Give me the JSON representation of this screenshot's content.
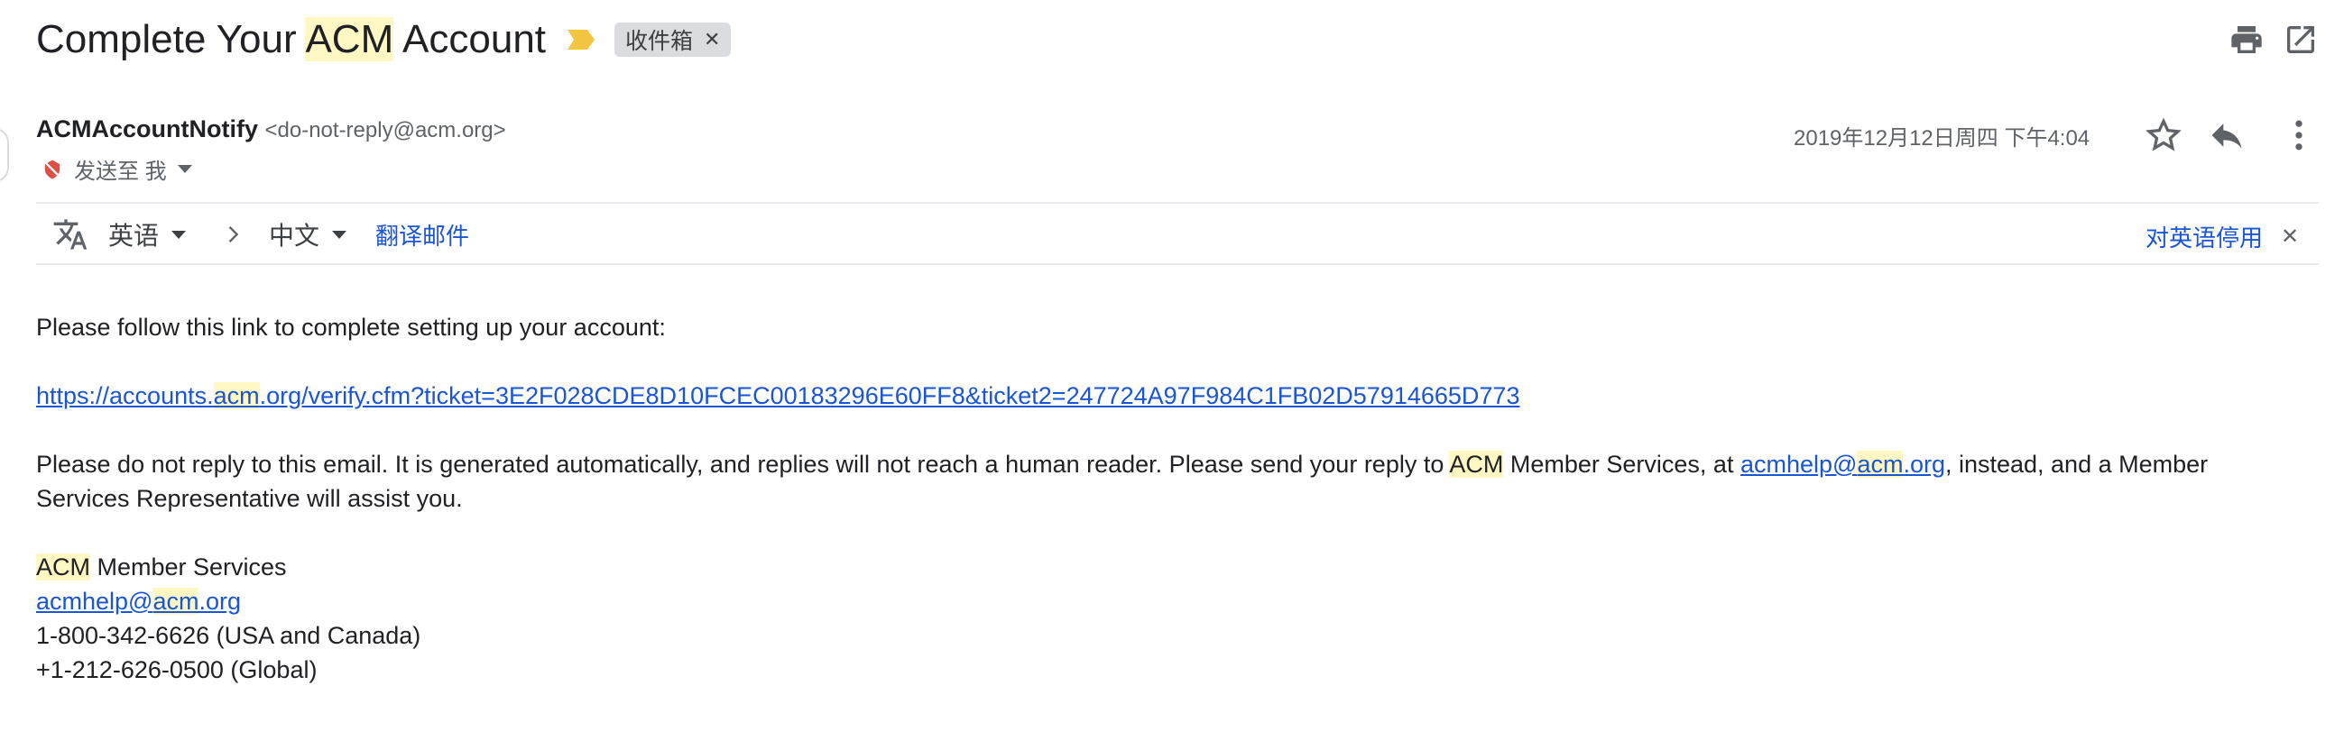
{
  "subject": {
    "before": "Complete Your ",
    "highlight": "ACM",
    "after": " Account",
    "label": "收件箱"
  },
  "sender": {
    "name": "ACMAccountNotify",
    "email": "<do-not-reply@acm.org>",
    "recipient": "发送至 我",
    "date": "2019年12月12日周四 下午4:04"
  },
  "translate": {
    "source_lang": "英语",
    "target_lang": "中文",
    "translate_link": "翻译邮件",
    "disable_link": "对英语停用"
  },
  "body": {
    "intro": "Please follow this link to complete setting up your account:",
    "link": {
      "part1": "https://accounts.",
      "hl": "acm",
      "part2": ".org/verify.cfm?ticket=3E2F028CDE8D10FCEC00183296E60FF8&ticket2=247724A97F984C1FB02D57914665D773"
    },
    "notice": {
      "part1": "Please do not reply to this email.  It is generated automatically, and replies will not reach a human reader.  Please send your reply to ",
      "hl": "ACM",
      "part2": " Member Services, at ",
      "email_part1": "acmhelp@",
      "email_hl": "acm",
      "email_part2": ".org",
      "part3": ", instead, and a Member Services Representative will assist you."
    },
    "signature": {
      "org_hl": "ACM",
      "org_rest": " Member Services",
      "email_part1": "acmhelp@",
      "email_hl": "acm",
      "email_part2": ".org",
      "phone_us": "1-800-342-6626 (USA and Canada)",
      "phone_global": "+1-212-626-0500 (Global)"
    }
  },
  "colors": {
    "highlight": "#fff8c5",
    "link": "#1a55d6",
    "importance": "#f4c542"
  },
  "icons": [
    "print-icon",
    "open-new-window-icon",
    "star-icon",
    "reply-icon",
    "more-vert-icon",
    "translate-icon",
    "importance-marker-icon",
    "muted-self-icon"
  ]
}
